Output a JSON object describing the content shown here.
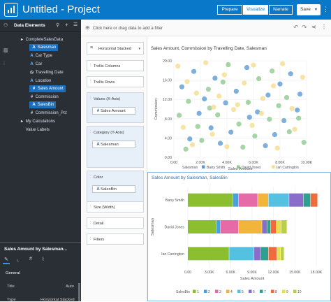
{
  "app": {
    "title": "Untitled - Project"
  },
  "modes": [
    "Prepare",
    "Visualize",
    "Narrate"
  ],
  "save_label": "Save",
  "left_panel": {
    "header": "Data Elements",
    "tree": [
      {
        "label": "CompleteSalesData",
        "glyph": "▸",
        "kind": "folder",
        "level": 0,
        "selected": false
      },
      {
        "label": "Salesman",
        "glyph": "A",
        "kind": "attr",
        "level": 1,
        "selected": true
      },
      {
        "label": "Car Type",
        "glyph": "A",
        "kind": "attr",
        "level": 1,
        "selected": false
      },
      {
        "label": "Car",
        "glyph": "A",
        "kind": "attr",
        "level": 1,
        "selected": false
      },
      {
        "label": "Travelling Date",
        "glyph": "◷",
        "kind": "date",
        "level": 1,
        "selected": false
      },
      {
        "label": "Location",
        "glyph": "A",
        "kind": "attr",
        "level": 1,
        "selected": false
      },
      {
        "label": "Sales Amount",
        "glyph": "#",
        "kind": "measure",
        "level": 1,
        "selected": true
      },
      {
        "label": "Commission",
        "glyph": "#",
        "kind": "measure",
        "level": 1,
        "selected": false
      },
      {
        "label": "SalesBin",
        "glyph": "A",
        "kind": "attr",
        "level": 1,
        "selected": true
      },
      {
        "label": "Commission_Pct",
        "glyph": "#",
        "kind": "measure",
        "level": 1,
        "selected": false
      },
      {
        "label": "My Calculations",
        "glyph": "▸",
        "kind": "folder",
        "level": 0,
        "selected": false
      },
      {
        "label": "Value Labels",
        "glyph": "",
        "kind": "plain",
        "level": 0,
        "selected": false
      }
    ],
    "properties": {
      "title": "Sales Amount by Salesman...",
      "section": "General",
      "rows": [
        {
          "label": "Title",
          "value": "Auto"
        },
        {
          "label": "Type",
          "value": "Horizontal Stacked"
        }
      ]
    }
  },
  "filter_bar": {
    "placeholder": "Click here or drag data to add a filter"
  },
  "grammar": {
    "chart_type": "Horizontal Stacked",
    "trellis_columns": "Trellis Columns",
    "trellis_rows": "Trellis Rows",
    "values_label": "Values (X-Axis)",
    "values_pill": "Sales Amount",
    "category_label": "Category (Y-Axis)",
    "category_pill": "Salesman",
    "color_label": "Color",
    "color_pill": "SalesBin",
    "size_label": "Size (Width)",
    "detail_label": "Detail",
    "filters_label": "Filters"
  },
  "chart_data": [
    {
      "type": "scatter",
      "title": "Sales Amount, Commission by Travelling Date, Salesman",
      "xlabel": "Sales Amount",
      "ylabel": "Commission",
      "xlim": [
        0,
        10000
      ],
      "ylim": [
        0,
        20
      ],
      "x_ticks": [
        "0.00",
        "2.00K",
        "4.00K",
        "6.00K",
        "8.00K",
        "10.00K"
      ],
      "y_ticks": [
        "0.00",
        "4.00",
        "8.00",
        "12.00",
        "16.00",
        "20.00"
      ],
      "legend_title": "Salesman",
      "legend_placement": "bottom",
      "series": [
        {
          "name": "Barry Smith",
          "color": "#5b9bd5",
          "points": [
            [
              600,
              14.6
            ],
            [
              1500,
              17.8
            ],
            [
              2300,
              12.1
            ],
            [
              3100,
              16.4
            ],
            [
              3900,
              11.3
            ],
            [
              4700,
              13.7
            ],
            [
              5500,
              18.6
            ],
            [
              6300,
              9.4
            ],
            [
              7100,
              12.9
            ],
            [
              8000,
              15.2
            ],
            [
              8800,
              17.3
            ],
            [
              9500,
              13.1
            ],
            [
              1200,
              3.8
            ],
            [
              2800,
              6.1
            ],
            [
              4300,
              5.2
            ],
            [
              5700,
              8.3
            ],
            [
              6900,
              2.4
            ],
            [
              8300,
              7.6
            ],
            [
              9300,
              9.8
            ],
            [
              1900,
              9.1
            ],
            [
              3500,
              2.9
            ],
            [
              7600,
              4.7
            ]
          ]
        },
        {
          "name": "David Jones",
          "color": "#8fc98f",
          "points": [
            [
              400,
              8.7
            ],
            [
              1100,
              11.6
            ],
            [
              1800,
              6.4
            ],
            [
              2600,
              14.1
            ],
            [
              3300,
              8.8
            ],
            [
              4100,
              19.2
            ],
            [
              4900,
              6.9
            ],
            [
              5600,
              11.4
            ],
            [
              6400,
              16.3
            ],
            [
              7200,
              7.9
            ],
            [
              7900,
              10.7
            ],
            [
              8700,
              5.3
            ],
            [
              9400,
              8.1
            ],
            [
              900,
              1.7
            ],
            [
              2100,
              3.5
            ],
            [
              3700,
              15.6
            ],
            [
              5200,
              2.1
            ],
            [
              6100,
              4.4
            ],
            [
              7400,
              17.9
            ],
            [
              8500,
              12.4
            ],
            [
              9800,
              3.1
            ],
            [
              2700,
              10.2
            ]
          ]
        },
        {
          "name": "Ian Carrington",
          "color": "#f5dd8f",
          "points": [
            [
              300,
              18.9
            ],
            [
              1000,
              15.7
            ],
            [
              1700,
              13.3
            ],
            [
              2400,
              19.6
            ],
            [
              3000,
              10.4
            ],
            [
              3800,
              17.1
            ],
            [
              4500,
              9.9
            ],
            [
              5300,
              15.4
            ],
            [
              6000,
              19.1
            ],
            [
              6700,
              12.2
            ],
            [
              7500,
              14.8
            ],
            [
              8200,
              19.4
            ],
            [
              8900,
              10.1
            ],
            [
              9700,
              16.6
            ],
            [
              700,
              6.2
            ],
            [
              1400,
              2.6
            ],
            [
              2900,
              4.8
            ],
            [
              4000,
              2.2
            ],
            [
              4800,
              10.9
            ],
            [
              5900,
              6.6
            ],
            [
              6600,
              9.1
            ],
            [
              7800,
              1.9
            ],
            [
              9100,
              5.8
            ],
            [
              3400,
              12.7
            ]
          ]
        }
      ]
    },
    {
      "type": "bar",
      "orientation": "horizontal",
      "stacked": true,
      "title": "Sales Amount by Salesman, SalesBin",
      "categories": [
        "Barry Smith",
        "David Jones",
        "Ian Carrington"
      ],
      "xlabel": "Sales Amount",
      "ylabel": "Salesman",
      "xlim": [
        0,
        18000
      ],
      "x_ticks": [
        "0.00",
        "3.00K",
        "6.00K",
        "9.00K",
        "12.00K",
        "15.00K",
        "18.00K"
      ],
      "legend_title": "SalesBin",
      "legend_placement": "bottom",
      "series": [
        {
          "name": "1",
          "color": "#8bbf2f",
          "values": [
            6300,
            4000,
            5800
          ]
        },
        {
          "name": "2",
          "color": "#49a1d9",
          "values": [
            800,
            600,
            0
          ]
        },
        {
          "name": "3",
          "color": "#e66aa7",
          "values": [
            2700,
            2500,
            0
          ]
        },
        {
          "name": "4",
          "color": "#f2b53c",
          "values": [
            1500,
            3300,
            0
          ]
        },
        {
          "name": "5",
          "color": "#55c1e0",
          "values": [
            2900,
            0,
            3500
          ]
        },
        {
          "name": "6",
          "color": "#8a6cc9",
          "values": [
            2000,
            700,
            900
          ]
        },
        {
          "name": "7",
          "color": "#2f9f8f",
          "values": [
            1000,
            500,
            1100
          ]
        },
        {
          "name": "8",
          "color": "#ef6a3c",
          "values": [
            1000,
            800,
            1200
          ]
        },
        {
          "name": "9",
          "color": "#e7e04e",
          "values": [
            0,
            700,
            500
          ]
        },
        {
          "name": "10",
          "color": "#b9cf46",
          "values": [
            0,
            800,
            500
          ]
        }
      ]
    }
  ]
}
